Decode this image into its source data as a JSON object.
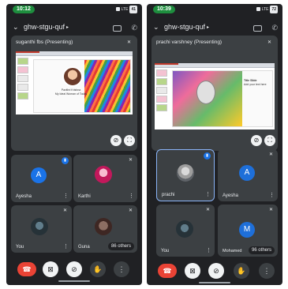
{
  "left": {
    "status": {
      "time": "10:12",
      "network": "LTE",
      "battery": "41"
    },
    "meeting_code": "ghw-stgu-quf",
    "presenter_label": "suganthi fbs (Presenting)",
    "slide": {
      "text_line1": "Pavithri Krishna",
      "text_line2": "My Ideal Woman of Today"
    },
    "tiles": [
      {
        "name": "Ayesha",
        "initial": "A"
      },
      {
        "name": "Karthi"
      },
      {
        "name": "You"
      },
      {
        "name": "Guna",
        "others": "86 others"
      }
    ]
  },
  "right": {
    "status": {
      "time": "10:39",
      "network": "LTE",
      "battery": "72"
    },
    "meeting_code": "ghw-stgu-quf",
    "presenter_label": "prachi varshney (Presenting)",
    "slide": {
      "text_line1": "Title Slide",
      "text_line2": "Add your text here"
    },
    "tiles": [
      {
        "name": "prachi"
      },
      {
        "name": "Ayesha",
        "initial": "A"
      },
      {
        "name": "You"
      },
      {
        "name": "Mohamed",
        "initial": "M",
        "others": "96 others"
      }
    ]
  },
  "colors": {
    "background": "#202124",
    "tile": "#3c4043",
    "end_call": "#ea4335",
    "accent": "#1a73e8",
    "status_green": "#1e8e3e"
  },
  "icons": {
    "back": "chevron-down-icon",
    "camera_flip": "camera-flip-icon",
    "phone": "phone-icon",
    "mic_off": "mic-off-icon",
    "fullscreen": "fullscreen-icon",
    "more": "more-vert-icon",
    "end_call": "call-end-icon",
    "camera_off": "camera-off-icon",
    "raise_hand": "hand-icon"
  }
}
